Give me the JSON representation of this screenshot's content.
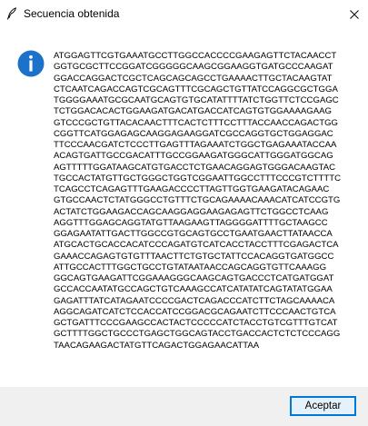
{
  "window": {
    "title": "Secuencia obtenida",
    "title_icon": "feather-icon",
    "close_icon": "close-icon"
  },
  "message": {
    "icon": "info-icon",
    "icon_color": "#1b72c8",
    "lines": [
      "ATGGAGTTCGTGAAATGCCTTGGCCACCCCGAAGAGTTCTACAACCT",
      "GGTGCGCTTCCGGATCGGGGGCAAGCGGAAGGTGATGCCCAAGAT",
      "GGACCAGGACTCGCTCAGCAGCAGCCTGAAAACTTGCTACAAGTAT",
      "CTCAATCAGACCAGTCGCAGTTTCGCAGCTGTTATCCAGGCGCTGGA",
      "TGGGGAAATGCGCAATGCAGTGTGCATATTTTATCTGGTTCTCCGAGC",
      "TCTGGACACACTGGAAGATGACATGACCATCAGTGTGGAAAAGAAG",
      "GTCCCGCTGTTACACAACTTTCACTCTTTCCTTTACCAACCAGACTGG",
      "CGGTTCATGGAGAGCAAGGAGAAGGATCGCCAGGTGCTGGAGGAC",
      "TTCCCAACGATCTCCCTTGAGTTTAGAAATCTGGCTGAGAAATACCAA",
      "ACAGTGATTGCCGACATTTGCCGGAAGATGGGCATTGGGATGGCAG",
      "AGTTTTTGGATAAGCATGTGACCTCTGAACAGGAGTGGGACAAGTAC",
      "TGCCACTATGTTGCTGGGCTGGTCGGAATTGGCCTTTCCCGTCTTTTC",
      "TCAGCCTCAGAGTTTGAAGACCCCTTAGTTGGTGAAGATACAGAAC",
      "GTGCCAACTCTATGGGCCTGTTTCTGCAGAAAACAAACATCATCCGTG",
      "ACTATCTGGAAGACCAGCAAGGAGGAAGAGAGTTCTGGCCTCAAG",
      "AGGTTTGGAGCAGGTATGTTAAGAAGTTAGGGGATTTTGCTAAGCC",
      "GGAGAATATTGACTTGGCCGTGCAGTGCCTGAATGAACTTATAACCA",
      "ATGCACTGCACCACATCCCAGATGTCATCACCTACCTTTCGAGACTCA",
      "GAAACCAGAGTGTGTTTAACTTCTGTGCTATTCCACAGGTGATGGCC",
      "ATTGCCACTTTGGCTGCCTGTATAATAACCAGCAGGTGTTCAAAGG",
      "GGCAGTGAAGATTCGGAAAGGGCAAGCAGTGACCCTCATGATGGAT",
      "GCCACCAATATGCCAGCTGTCAAAGCCATCATATATCAGTATATGGAA",
      "GAGATTTATCATAGAATCCCCGACTCAGACCCATCTTCTAGCAAAACA",
      "AGGCAGATCATCTCCACCATCCGGACGCAGAATCTTCCCAACTGTCA",
      "GCTGATTTCCCGAAGCCACTACTCCCCCATCTACCTGTCGTTTGTCAT",
      "GCTTTTGGCTGCCCTGAGCTGGCAGTACCTGACCACTCTCTCCCAGG",
      "TAACAGAAGACTATGTTCAGACTGGAGAACATTAA"
    ]
  },
  "footer": {
    "ok_label": "Aceptar",
    "button_border_color": "#0078d7",
    "button_bg_color": "#e5f1fb",
    "footer_bg_color": "#f0f0f0"
  }
}
